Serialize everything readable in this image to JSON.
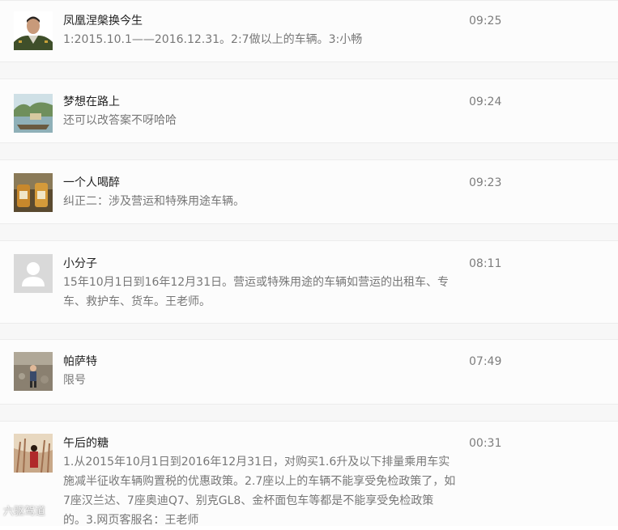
{
  "comments": [
    {
      "name": "凤凰涅槃换今生",
      "time": "09:25",
      "text": "1:2015.10.1——2016.12.31。2:7做以上的车辆。3:小畅"
    },
    {
      "name": "梦想在路上",
      "time": "09:24",
      "text": "还可以改答案不呀哈哈"
    },
    {
      "name": "一个人喝醉",
      "time": "09:23",
      "text": "纠正二：涉及营运和特殊用途车辆。"
    },
    {
      "name": "小分子",
      "time": "08:11",
      "text": "15年10月1日到16年12月31日。营运或特殊用途的车辆如营运的出租车、专车、救护车、货车。王老师。"
    },
    {
      "name": "帕萨特",
      "time": "07:49",
      "text": "限号"
    },
    {
      "name": "午后的糖",
      "time": "00:31",
      "text": "1.从2015年10月1日到2016年12月31日，对购买1.6升及以下排量乘用车实施减半征收车辆购置税的优惠政策。2.7座以上的车辆不能享受免检政策了，如7座汉兰达、7座奥迪Q7、别克GL8、金杯面包车等都是不能享受免检政策的。3.网页客服名：王老师"
    }
  ],
  "watermark": "六驱驾道",
  "colors": {
    "row_bg": "#fcfcfc",
    "gap_bg": "#f7f7f7",
    "text": "#777777",
    "name": "#222222",
    "time": "#7d7d7d"
  }
}
